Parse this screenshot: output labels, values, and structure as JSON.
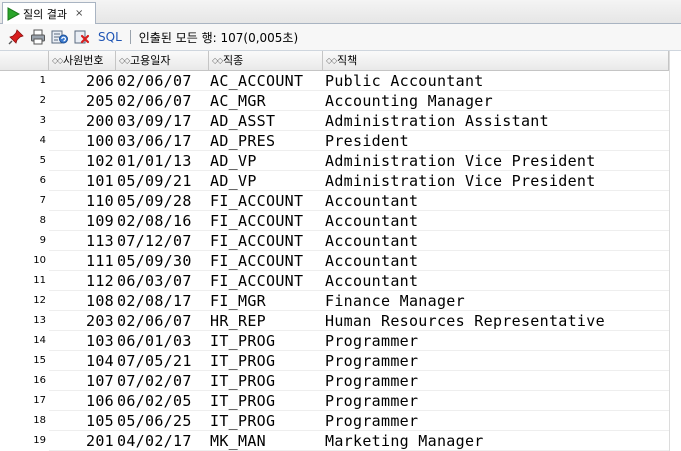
{
  "tab": {
    "label": "질의 결과",
    "close_glyph": "×"
  },
  "toolbar": {
    "sql_label": "SQL",
    "status": "인출된 모든 행: 107(0,005초)"
  },
  "icons": {
    "run": "run-icon",
    "pin": "pin-icon",
    "print": "print-icon",
    "refresh": "refresh-icon",
    "delete": "delete-icon"
  },
  "colors": {
    "run_green": "#2aa52a",
    "pin_red": "#d81e1e",
    "sql_blue": "#1f55b5"
  },
  "table": {
    "columns": [
      "사원번호",
      "고용일자",
      "직종",
      "직책"
    ],
    "rows": [
      {
        "n": "1",
        "id": "206",
        "date": "02/06/07",
        "job": "AC_ACCOUNT",
        "title": "Public Accountant"
      },
      {
        "n": "2",
        "id": "205",
        "date": "02/06/07",
        "job": "AC_MGR",
        "title": "Accounting Manager"
      },
      {
        "n": "3",
        "id": "200",
        "date": "03/09/17",
        "job": "AD_ASST",
        "title": "Administration Assistant"
      },
      {
        "n": "4",
        "id": "100",
        "date": "03/06/17",
        "job": "AD_PRES",
        "title": "President"
      },
      {
        "n": "5",
        "id": "102",
        "date": "01/01/13",
        "job": "AD_VP",
        "title": "Administration Vice President"
      },
      {
        "n": "6",
        "id": "101",
        "date": "05/09/21",
        "job": "AD_VP",
        "title": "Administration Vice President"
      },
      {
        "n": "7",
        "id": "110",
        "date": "05/09/28",
        "job": "FI_ACCOUNT",
        "title": "Accountant"
      },
      {
        "n": "8",
        "id": "109",
        "date": "02/08/16",
        "job": "FI_ACCOUNT",
        "title": "Accountant"
      },
      {
        "n": "9",
        "id": "113",
        "date": "07/12/07",
        "job": "FI_ACCOUNT",
        "title": "Accountant"
      },
      {
        "n": "10",
        "id": "111",
        "date": "05/09/30",
        "job": "FI_ACCOUNT",
        "title": "Accountant"
      },
      {
        "n": "11",
        "id": "112",
        "date": "06/03/07",
        "job": "FI_ACCOUNT",
        "title": "Accountant"
      },
      {
        "n": "12",
        "id": "108",
        "date": "02/08/17",
        "job": "FI_MGR",
        "title": "Finance Manager"
      },
      {
        "n": "13",
        "id": "203",
        "date": "02/06/07",
        "job": "HR_REP",
        "title": "Human Resources Representative"
      },
      {
        "n": "14",
        "id": "103",
        "date": "06/01/03",
        "job": "IT_PROG",
        "title": "Programmer"
      },
      {
        "n": "15",
        "id": "104",
        "date": "07/05/21",
        "job": "IT_PROG",
        "title": "Programmer"
      },
      {
        "n": "16",
        "id": "107",
        "date": "07/02/07",
        "job": "IT_PROG",
        "title": "Programmer"
      },
      {
        "n": "17",
        "id": "106",
        "date": "06/02/05",
        "job": "IT_PROG",
        "title": "Programmer"
      },
      {
        "n": "18",
        "id": "105",
        "date": "05/06/25",
        "job": "IT_PROG",
        "title": "Programmer"
      },
      {
        "n": "19",
        "id": "201",
        "date": "04/02/17",
        "job": "MK_MAN",
        "title": "Marketing Manager"
      }
    ]
  }
}
